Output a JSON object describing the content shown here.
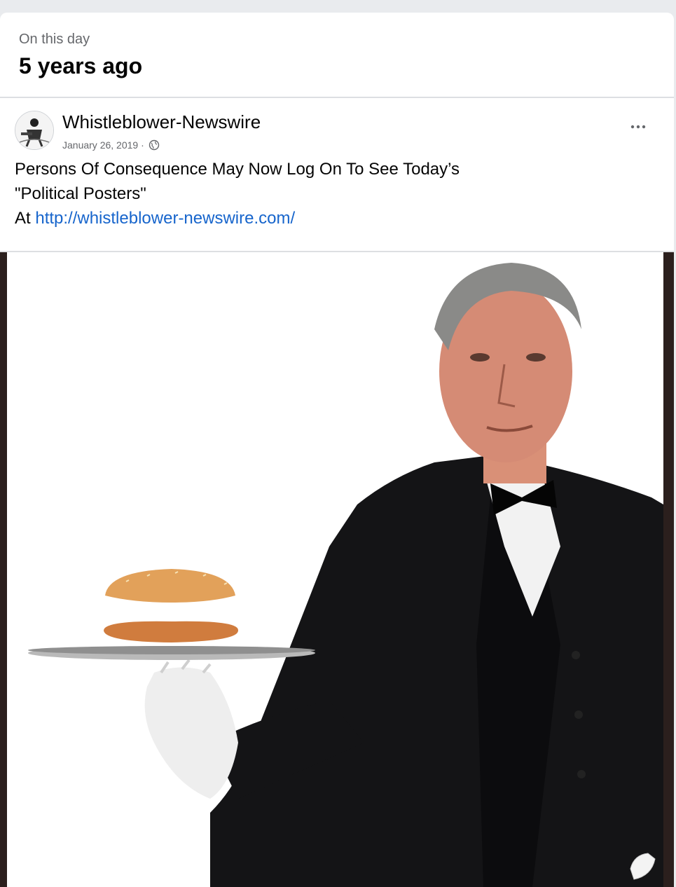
{
  "memory": {
    "kicker": "On this day",
    "headline": "5 years ago"
  },
  "post": {
    "author": "Whistleblower-Newswire",
    "date": "January 26, 2019 ·",
    "privacy_icon": "globe-icon",
    "more_icon": "more-options-icon",
    "text_line_1": "Persons Of Consequence May Now Log On To See Today’s",
    "text_line_2": "\"Political Posters\"",
    "text_line_3_prefix": "At ",
    "link": "http://whistleblower-newswire.com/"
  },
  "photo": {
    "description_icon": "photo-image"
  },
  "colors": {
    "link": "#1765cc",
    "muted": "#65676b",
    "card_bg": "#ffffff",
    "page_bg": "#e9ebee"
  }
}
